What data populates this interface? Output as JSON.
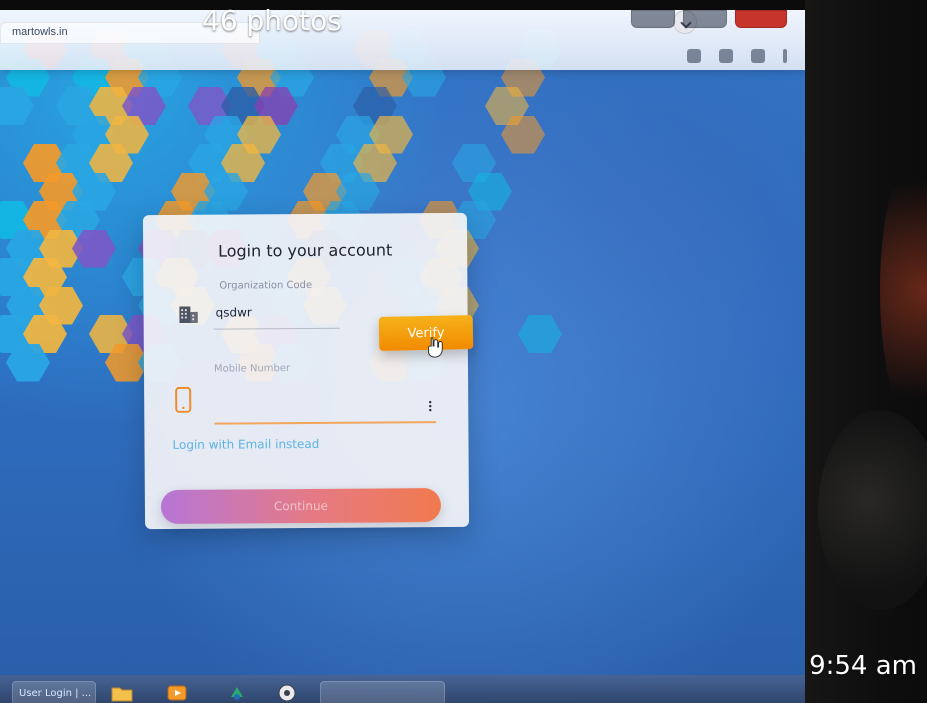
{
  "viewer": {
    "photo_count": "46 photos",
    "time": "9:54 am"
  },
  "browser": {
    "tab_url": "martowls.in"
  },
  "login": {
    "title": "Login to your account",
    "organization_code_label": "Organization Code",
    "organization_code_value": "qsdwr",
    "verify_label": "Verify",
    "mobile_label": "Mobile Number",
    "mobile_value": "",
    "email_instead_link": "Login with Email instead",
    "continue_label": "Continue"
  },
  "taskbar": {
    "active_item_label": "User Login | ..."
  },
  "colors": {
    "verify_orange": "#F39A0C",
    "continue_gradient_start": "#B676D6",
    "continue_gradient_end": "#F07A4E",
    "link_blue": "#5DB3E5",
    "card_bg": "#F4F4F7"
  }
}
